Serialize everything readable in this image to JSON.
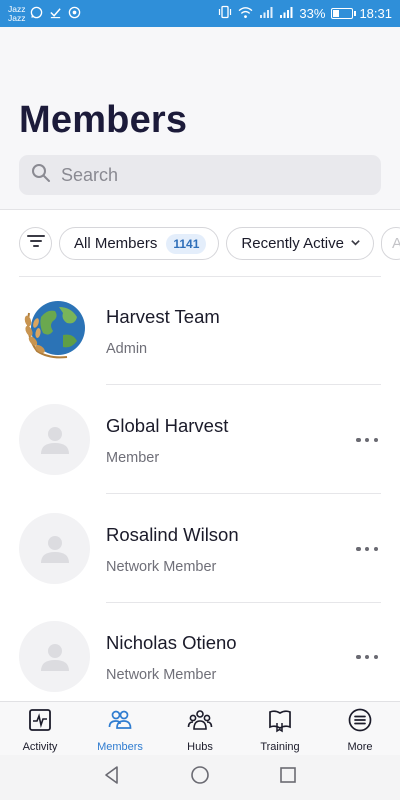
{
  "status_bar": {
    "carrier_1": "Jazz",
    "carrier_2": "Jazz",
    "battery": "33%",
    "battery_level": 0.33,
    "time": "18:31"
  },
  "header": {
    "title": "Members",
    "search_placeholder": "Search"
  },
  "filters": {
    "all_members_label": "All Members",
    "all_members_count": "1141",
    "sort_label": "Recently Active",
    "partial_chip": "A"
  },
  "members": [
    {
      "name": "Harvest Team",
      "role": "Admin"
    },
    {
      "name": "Global Harvest",
      "role": "Member"
    },
    {
      "name": "Rosalind Wilson",
      "role": "Network Member"
    },
    {
      "name": "Nicholas Otieno",
      "role": "Network Member"
    }
  ],
  "tabs": [
    {
      "label": "Activity",
      "icon": "activity-icon"
    },
    {
      "label": "Members",
      "icon": "members-icon"
    },
    {
      "label": "Hubs",
      "icon": "hubs-icon"
    },
    {
      "label": "Training",
      "icon": "training-icon"
    },
    {
      "label": "More",
      "icon": "more-menu-icon"
    }
  ],
  "colors": {
    "status_bar": "#2f8fd9",
    "accent": "#2f7cd0",
    "title": "#1c1b3a"
  }
}
